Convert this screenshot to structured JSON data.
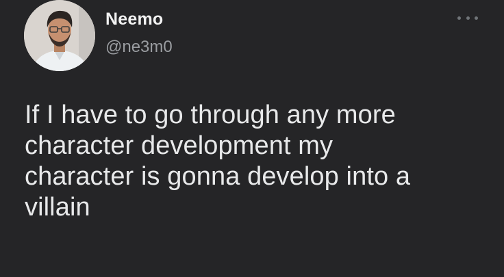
{
  "tweet": {
    "display_name": "Neemo",
    "handle": "@ne3m0",
    "text": "If I have to go through any more\ncharacter development my\ncharacter is gonna develop into a\nvillain",
    "avatar_icon": "profile-photo",
    "more_icon": "more-options-icon"
  },
  "colors": {
    "background": "#252527",
    "primary_text": "#e7e9ea",
    "secondary_text": "#9a9da1"
  }
}
